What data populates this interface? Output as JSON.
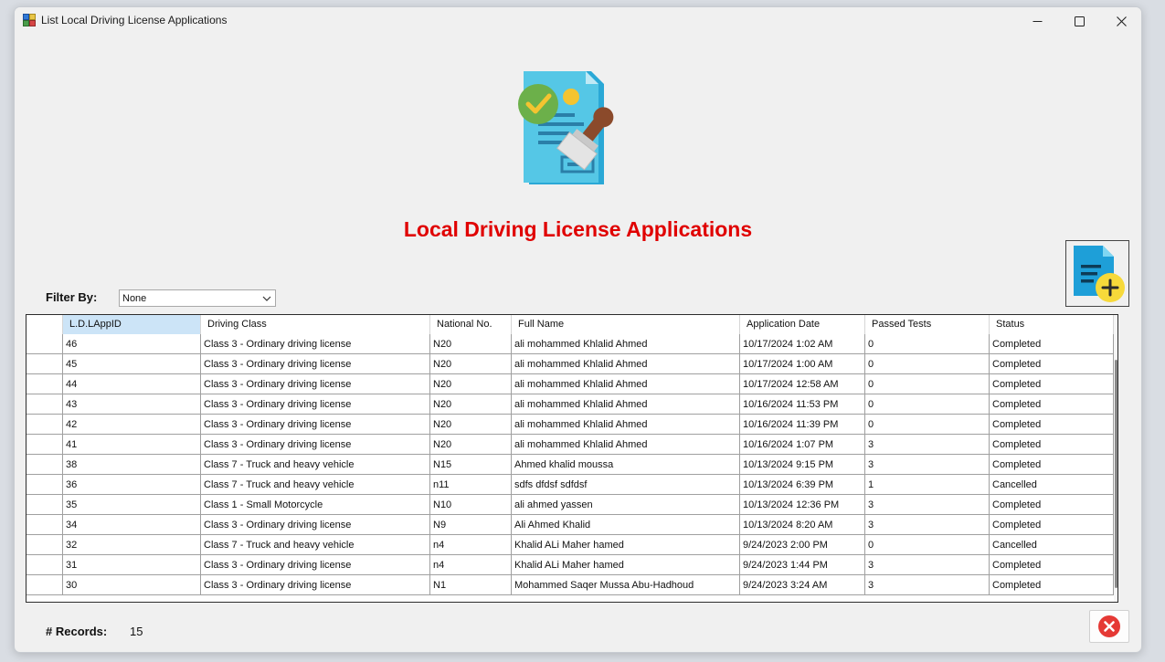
{
  "window": {
    "title": "List Local Driving License Applications"
  },
  "heading": "Local Driving License Applications",
  "filter": {
    "label": "Filter By:",
    "selected": "None"
  },
  "grid": {
    "columns": [
      "L.D.LAppID",
      "Driving Class",
      "National No.",
      "Full Name",
      "Application Date",
      "Passed Tests",
      "Status"
    ],
    "rows": [
      [
        "46",
        "Class 3 - Ordinary driving license",
        "N20",
        "ali mohammed Khlalid Ahmed",
        "10/17/2024 1:02 AM",
        "0",
        "Completed"
      ],
      [
        "45",
        "Class 3 - Ordinary driving license",
        "N20",
        "ali mohammed Khlalid Ahmed",
        "10/17/2024 1:00 AM",
        "0",
        "Completed"
      ],
      [
        "44",
        "Class 3 - Ordinary driving license",
        "N20",
        "ali mohammed Khlalid Ahmed",
        "10/17/2024 12:58 AM",
        "0",
        "Completed"
      ],
      [
        "43",
        "Class 3 - Ordinary driving license",
        "N20",
        "ali mohammed Khlalid Ahmed",
        "10/16/2024 11:53 PM",
        "0",
        "Completed"
      ],
      [
        "42",
        "Class 3 - Ordinary driving license",
        "N20",
        "ali mohammed Khlalid Ahmed",
        "10/16/2024 11:39 PM",
        "0",
        "Completed"
      ],
      [
        "41",
        "Class 3 - Ordinary driving license",
        "N20",
        "ali mohammed Khlalid Ahmed",
        "10/16/2024 1:07 PM",
        "3",
        "Completed"
      ],
      [
        "38",
        "Class 7 - Truck and heavy vehicle",
        "N15",
        "Ahmed khalid  moussa",
        "10/13/2024 9:15 PM",
        "3",
        "Completed"
      ],
      [
        "36",
        "Class 7 - Truck and heavy vehicle",
        "n11",
        "sdfs dfdsf  sdfdsf",
        "10/13/2024 6:39 PM",
        "1",
        "Cancelled"
      ],
      [
        "35",
        "Class 1 - Small Motorcycle",
        "N10",
        "ali ahmed  yassen",
        "10/13/2024 12:36 PM",
        "3",
        "Completed"
      ],
      [
        "34",
        "Class 3 - Ordinary driving license",
        "N9",
        "Ali Ahmed  Khalid",
        "10/13/2024 8:20 AM",
        "3",
        "Completed"
      ],
      [
        "32",
        "Class 7 - Truck and heavy vehicle",
        "n4",
        "Khalid ALi Maher hamed",
        "9/24/2023 2:00 PM",
        "0",
        "Cancelled"
      ],
      [
        "31",
        "Class 3 - Ordinary driving license",
        "n4",
        "Khalid ALi Maher hamed",
        "9/24/2023 1:44 PM",
        "3",
        "Completed"
      ],
      [
        "30",
        "Class 3 - Ordinary driving license",
        "N1",
        "Mohammed Saqer Mussa Abu-Hadhoud",
        "9/24/2023 3:24 AM",
        "3",
        "Completed"
      ]
    ]
  },
  "records": {
    "label": "# Records:",
    "count": "15"
  },
  "icons": {
    "app": "app-icon",
    "hero": "license-document-stamp-icon",
    "add": "add-document-icon",
    "close": "close-circle-icon"
  },
  "colors": {
    "heading": "#e00000",
    "selected_header": "#cce4f7",
    "close_accent": "#e53935"
  }
}
